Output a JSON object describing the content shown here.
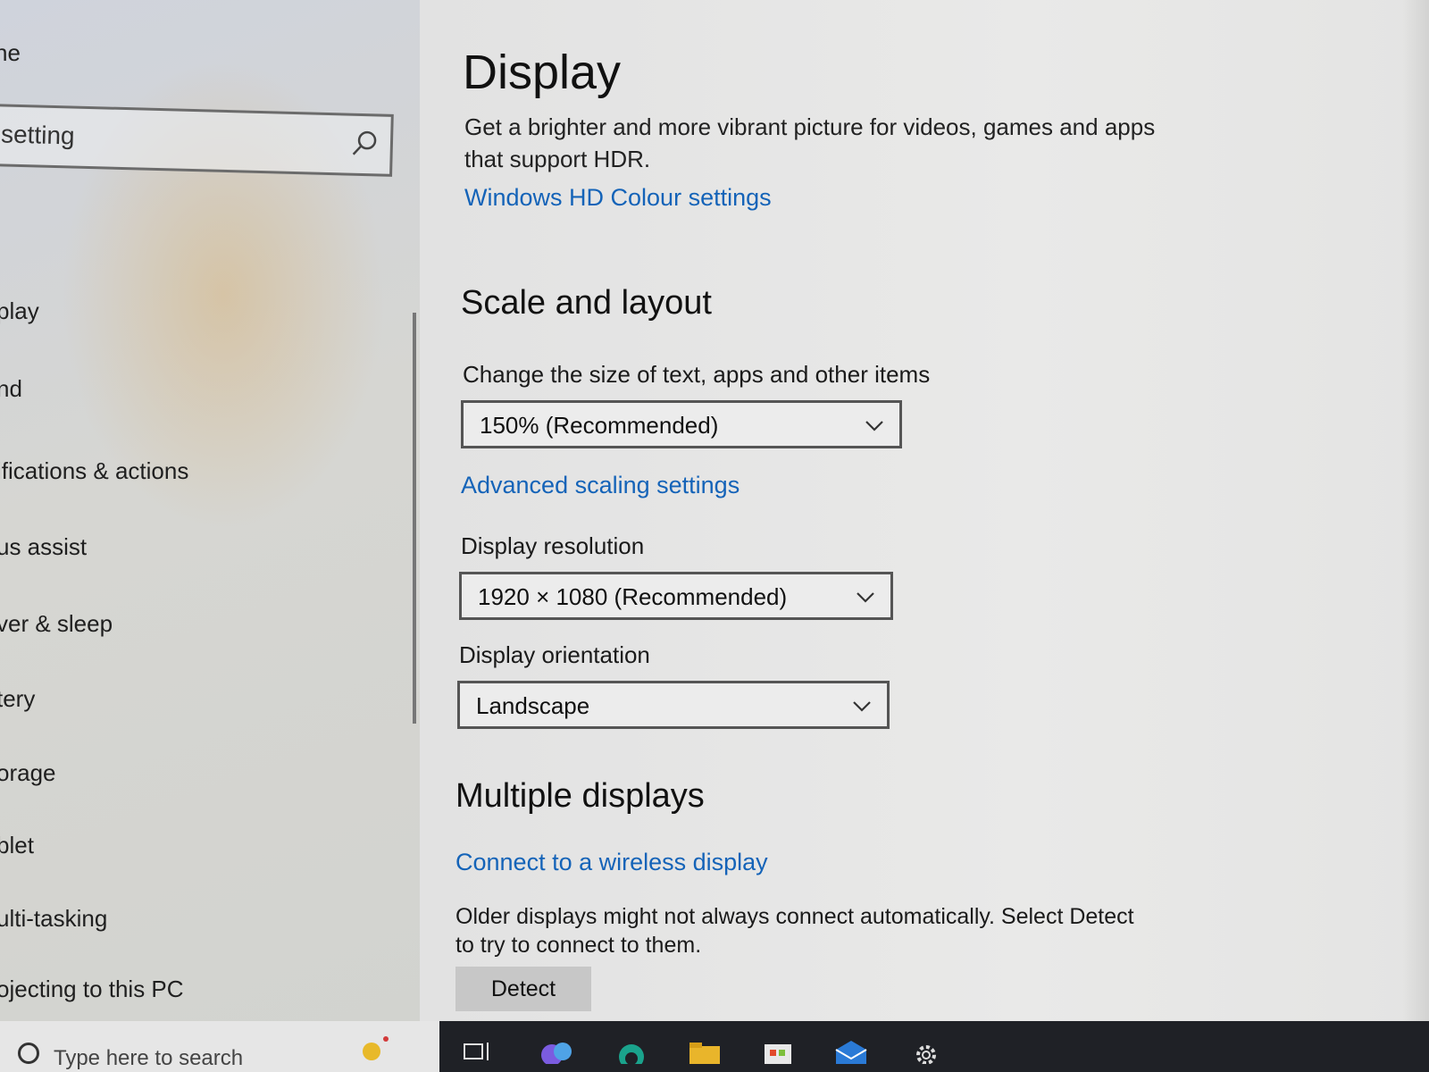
{
  "sidebar": {
    "title": "ne",
    "search": {
      "value": "setting",
      "placeholder": ""
    },
    "items": [
      {
        "label": "play"
      },
      {
        "label": "nd"
      },
      {
        "label": "ifications & actions"
      },
      {
        "label": "us assist"
      },
      {
        "label": "ver & sleep"
      },
      {
        "label": "tery"
      },
      {
        "label": "orage"
      },
      {
        "label": "blet"
      },
      {
        "label": "ulti-tasking"
      },
      {
        "label": "ojecting to this PC"
      }
    ]
  },
  "main": {
    "title": "Display",
    "hdr_description": "Get a brighter and more vibrant picture for videos, games and apps that support HDR.",
    "hdr_link": "Windows HD Colour settings",
    "scale_section": {
      "heading": "Scale and layout",
      "size_label": "Change the size of text, apps and other items",
      "size_value": "150% (Recommended)",
      "advanced_link": "Advanced scaling settings",
      "resolution_label": "Display resolution",
      "resolution_value": "1920 × 1080 (Recommended)",
      "orientation_label": "Display orientation",
      "orientation_value": "Landscape"
    },
    "multiple_section": {
      "heading": "Multiple displays",
      "wireless_link": "Connect to a wireless display",
      "older_text": "Older displays might not always connect automatically. Select Detect to try to connect to them.",
      "detect_label": "Detect"
    }
  },
  "taskbar": {
    "search_text": "Type here to search"
  },
  "colors": {
    "link": "#1463b8",
    "taskbar_dark": "#1f2126"
  }
}
